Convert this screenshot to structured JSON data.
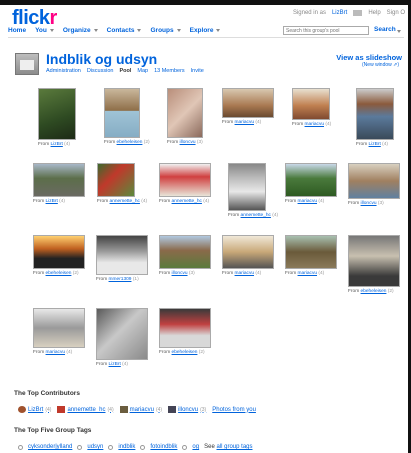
{
  "header": {
    "logo_blue": "flick",
    "logo_pink": "r",
    "signed_in": "Signed in as",
    "user": "LizBrt",
    "help": "Help",
    "signout": "Sign O"
  },
  "nav": {
    "items": [
      "Home",
      "You",
      "Organize",
      "Contacts",
      "Groups",
      "Explore"
    ],
    "search_placeholder": "Search this group's pool",
    "search_label": "Search"
  },
  "group": {
    "title": "Indblik og udsyn",
    "subnav": [
      "Administration",
      "Discussion",
      "Pool",
      "Map",
      "13 Members",
      "Invite"
    ],
    "active_tab": "Pool",
    "slideshow": "View as slideshow",
    "new_window": "(New window  ⇗)"
  },
  "photos": [
    {
      "from": "From",
      "user": "LizBrt",
      "n": "(4)"
    },
    {
      "from": "From",
      "user": "ebeheleisen",
      "n": "(2)"
    },
    {
      "from": "From",
      "user": "illoncvu",
      "n": "(3)"
    },
    {
      "from": "From",
      "user": "mariacvu",
      "n": "(4)"
    },
    {
      "from": "From",
      "user": "mariacvu",
      "n": "(4)"
    },
    {
      "from": "From",
      "user": "LizBrt",
      "n": "(4)"
    },
    {
      "from": "From",
      "user": "LizBrt",
      "n": "(4)"
    },
    {
      "from": "From",
      "user": "annemette_hc",
      "n": "(4)"
    },
    {
      "from": "From",
      "user": "annemette_hc",
      "n": "(4)"
    },
    {
      "from": "From",
      "user": "annemette_hc",
      "n": "(4)"
    },
    {
      "from": "From",
      "user": "mariacvu",
      "n": "(4)"
    },
    {
      "from": "From",
      "user": "illoncvu",
      "n": "(3)"
    },
    {
      "from": "From",
      "user": "ebeheleisen",
      "n": "(2)"
    },
    {
      "from": "From",
      "user": "mmer1309",
      "n": "(1)"
    },
    {
      "from": "From",
      "user": "illoncvu",
      "n": "(3)"
    },
    {
      "from": "From",
      "user": "mariacvu",
      "n": "(4)"
    },
    {
      "from": "From",
      "user": "mariacvu",
      "n": "(4)"
    },
    {
      "from": "From",
      "user": "ebeheleisen",
      "n": "(2)"
    },
    {
      "from": "From",
      "user": "mariacvu",
      "n": "(4)"
    },
    {
      "from": "From",
      "user": "LizBrt",
      "n": "(4)"
    },
    {
      "from": "From",
      "user": "ebeheleisen",
      "n": "(2)"
    }
  ],
  "contributors": {
    "heading": "The Top Contributors",
    "list": [
      {
        "name": "LizBrt",
        "count": "(4)"
      },
      {
        "name": "annemette_hc",
        "count": "(4)"
      },
      {
        "name": "mariacvu",
        "count": "(4)"
      },
      {
        "name": "illoncvu",
        "count": "(3)"
      }
    ],
    "photos_from_you": "Photos from you"
  },
  "tags": {
    "heading": "The Top Five Group Tags",
    "list": [
      "cyksonderjylland",
      "udsyn",
      "indblik",
      "fotoindblik",
      "og"
    ],
    "see_prefix": "See",
    "see_link": "all group tags"
  },
  "colors": {
    "flickr_blue": "#0063dc",
    "flickr_pink": "#ff0084"
  }
}
